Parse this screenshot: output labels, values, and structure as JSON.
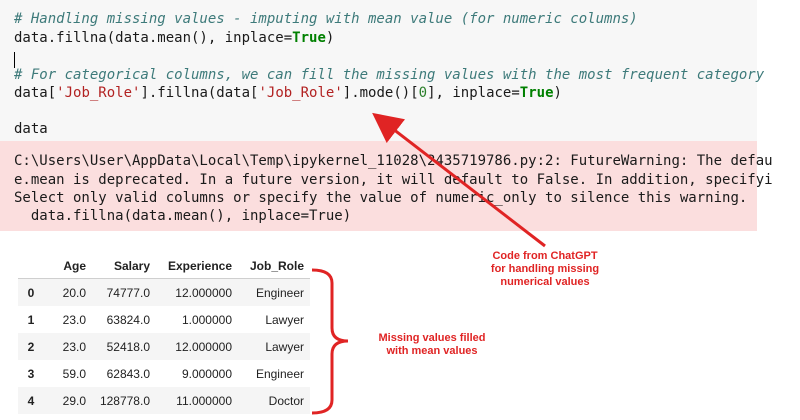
{
  "code": {
    "line1": "# Handling missing values - imputing with mean value (for numeric columns)",
    "line2_pre": "data.fillna(data.mean(), inplace=",
    "line2_kw": "True",
    "line2_post": ")",
    "line3": "# For categorical columns, we can fill the missing values with the most frequent category",
    "line4_a": "data[",
    "line4_s1": "'Job_Role'",
    "line4_b": "].fillna(data[",
    "line4_s2": "'Job_Role'",
    "line4_c": "].mode()[",
    "line4_n": "0",
    "line4_d": "], inplace=",
    "line4_kw": "True",
    "line4_e": ")",
    "line5": "data"
  },
  "warning": {
    "line1": "C:\\Users\\User\\AppData\\Local\\Temp\\ipykernel_11028\\2435719786.py:2: FutureWarning: The defau",
    "line2": "e.mean is deprecated. In a future version, it will default to False. In addition, specifyi",
    "line3": "Select only valid columns or specify the value of numeric_only to silence this warning.",
    "line4": "  data.fillna(data.mean(), inplace=True)"
  },
  "table": {
    "columns": [
      "",
      "Age",
      "Salary",
      "Experience",
      "Job_Role"
    ],
    "rows": [
      [
        "0",
        "20.0",
        "74777.0",
        "12.000000",
        "Engineer"
      ],
      [
        "1",
        "23.0",
        "63824.0",
        "1.000000",
        "Lawyer"
      ],
      [
        "2",
        "23.0",
        "52418.0",
        "12.000000",
        "Lawyer"
      ],
      [
        "3",
        "59.0",
        "62843.0",
        "9.000000",
        "Engineer"
      ],
      [
        "4",
        "29.0",
        "128778.0",
        "11.000000",
        "Doctor"
      ]
    ]
  },
  "annotations": {
    "code_note": "Code from ChatGPT for handling missing numerical values",
    "code_note_l1": "Code from ChatGPT",
    "code_note_l2": "for handling missing",
    "code_note_l3": "numerical values",
    "table_note_l1": "Missing values filled",
    "table_note_l2": "with mean values",
    "color": "#e02424"
  }
}
